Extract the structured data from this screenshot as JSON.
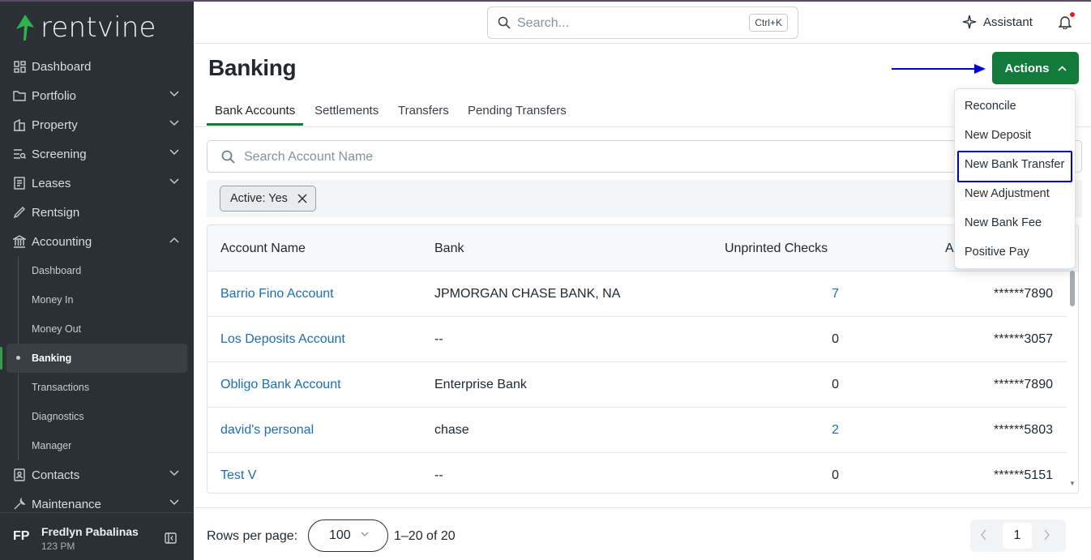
{
  "brand": {
    "name": "rentvine",
    "accent": "#127a3b",
    "sidebar_bg": "#2b3035",
    "link_color": "#1b6fb5"
  },
  "sidebar": {
    "items": [
      {
        "label": "Dashboard",
        "icon": "dashboard-icon",
        "expandable": false
      },
      {
        "label": "Portfolio",
        "icon": "folder-icon",
        "expandable": true
      },
      {
        "label": "Property",
        "icon": "building-icon",
        "expandable": true
      },
      {
        "label": "Screening",
        "icon": "screening-icon",
        "expandable": true
      },
      {
        "label": "Leases",
        "icon": "document-icon",
        "expandable": true
      },
      {
        "label": "Rentsign",
        "icon": "signature-icon",
        "expandable": false
      },
      {
        "label": "Accounting",
        "icon": "bank-icon",
        "expandable": true,
        "expanded": true
      }
    ],
    "accounting_sub": [
      "Dashboard",
      "Money In",
      "Money Out",
      "Banking",
      "Transactions",
      "Diagnostics",
      "Manager"
    ],
    "active_sub": "Banking",
    "after_items": [
      {
        "label": "Contacts",
        "icon": "contacts-icon"
      },
      {
        "label": "Maintenance",
        "icon": "wrench-icon"
      }
    ]
  },
  "user": {
    "initials": "FP",
    "name": "Fredlyn Pabalinas",
    "sub": "123 PM"
  },
  "header": {
    "search_placeholder": "Search...",
    "shortcut": "Ctrl+K",
    "assistant_label": "Assistant"
  },
  "page": {
    "title": "Banking",
    "actions_label": "Actions"
  },
  "tabs": [
    "Bank Accounts",
    "Settlements",
    "Transfers",
    "Pending Transfers"
  ],
  "active_tab": "Bank Accounts",
  "account_search": {
    "placeholder": "Search Account Name"
  },
  "filter_chip": "Active: Yes",
  "table": {
    "columns": [
      "Account Name",
      "Bank",
      "Unprinted Checks",
      "A"
    ],
    "rows": [
      {
        "name": "Barrio Fino Account",
        "bank": "JPMORGAN CHASE BANK, NA",
        "unprinted": "7",
        "account": "******7890"
      },
      {
        "name": "Los Deposits Account",
        "bank": "--",
        "unprinted": "0",
        "account": "******3057"
      },
      {
        "name": "Obligo Bank Account",
        "bank": "Enterprise Bank",
        "unprinted": "0",
        "account": "******7890"
      },
      {
        "name": "david's personal",
        "bank": "chase",
        "unprinted": "2",
        "account": "******5803"
      },
      {
        "name": "Test V",
        "bank": "--",
        "unprinted": "0",
        "account": "******5151"
      }
    ]
  },
  "footer": {
    "rows_per_page_label": "Rows per page:",
    "rows_per_page": "100",
    "range": "1–20 of 20",
    "page": "1"
  },
  "actions_menu": [
    "Reconcile",
    "New Deposit",
    "New Bank Transfer",
    "New Adjustment",
    "New Bank Fee",
    "Positive Pay"
  ],
  "highlighted_menu_item": "New Bank Transfer"
}
